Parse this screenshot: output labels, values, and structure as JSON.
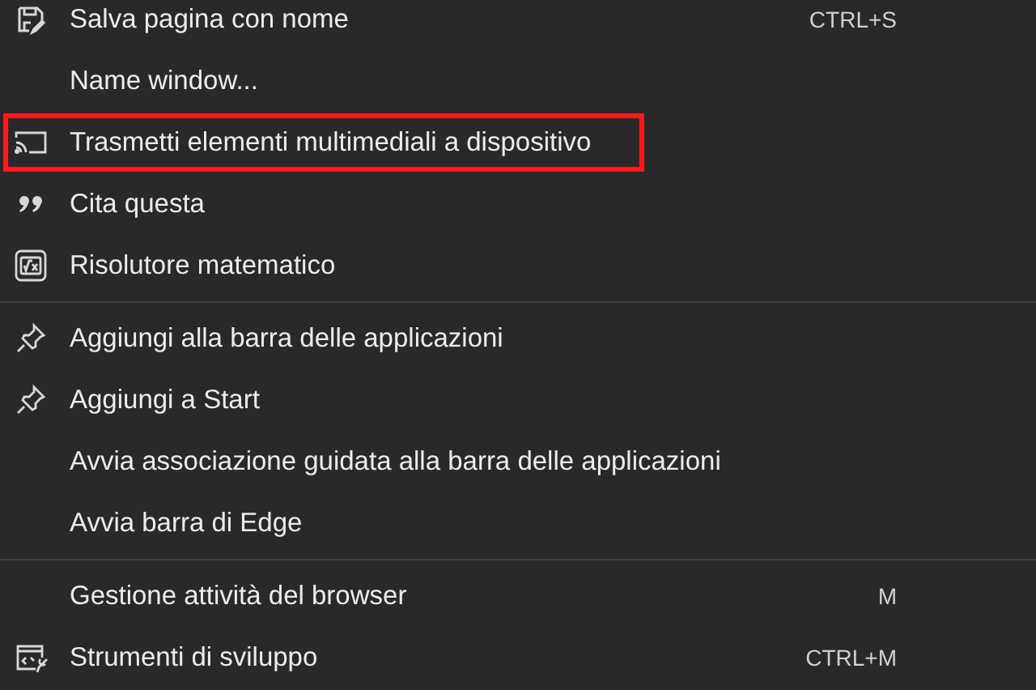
{
  "menu": {
    "groups": [
      {
        "items": [
          {
            "label": "Salva pagina con nome",
            "kind": "save",
            "shortcut": "CTRL+S",
            "highlighted": false
          },
          {
            "label": "Name window...",
            "kind": "plain",
            "highlighted": false
          },
          {
            "label": "Trasmetti elementi multimediali a dispositivo",
            "kind": "cast",
            "highlighted": true
          },
          {
            "label": "Cita questa",
            "kind": "quote",
            "highlighted": false
          },
          {
            "label": "Risolutore matematico",
            "kind": "math",
            "highlighted": false
          }
        ]
      },
      {
        "items": [
          {
            "label": "Aggiungi alla barra delle applicazioni",
            "kind": "pin",
            "highlighted": false
          },
          {
            "label": "Aggiungi a Start",
            "kind": "pin",
            "highlighted": false
          },
          {
            "label": "Avvia associazione guidata alla barra delle applicazioni",
            "kind": "plain",
            "highlighted": false
          },
          {
            "label": "Avvia barra di Edge",
            "kind": "plain",
            "highlighted": false
          }
        ]
      },
      {
        "items": [
          {
            "label": "Gestione attività del browser",
            "kind": "plain",
            "shortcut": "M",
            "highlighted": false
          },
          {
            "label": "Strumenti di sviluppo",
            "kind": "devtools",
            "shortcut": "CTRL+M",
            "highlighted": false
          }
        ]
      }
    ]
  }
}
